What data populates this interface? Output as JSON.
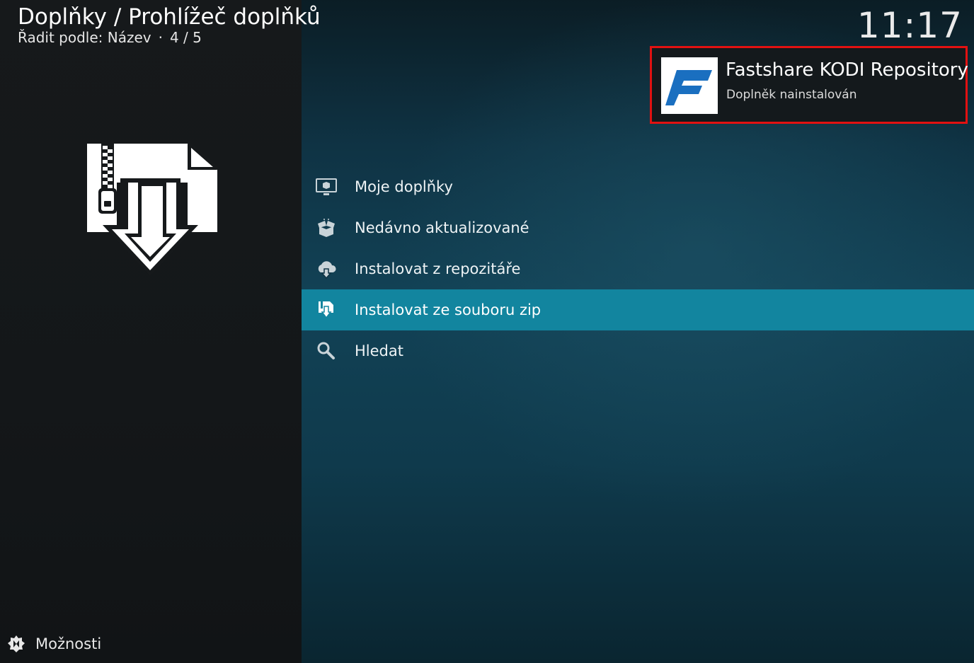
{
  "header": {
    "title": "Doplňky / Prohlížeč doplňků",
    "sort_label": "Řadit podle: Název",
    "separator": "·",
    "position": "4 / 5"
  },
  "clock": "11:17",
  "notification": {
    "title": "Fastshare KODI Repository",
    "message": "Doplněk nainstalován",
    "thumbnail_icon": "fastshare-logo-icon",
    "accent_color": "#1a6fc0",
    "highlight_color": "#e21111"
  },
  "hero": {
    "icon": "install-from-zip-icon"
  },
  "menu": {
    "selected_index": 3,
    "items": [
      {
        "label": "Moje doplňky",
        "icon": "monitor-box-icon"
      },
      {
        "label": "Nedávno aktualizované",
        "icon": "open-box-icon"
      },
      {
        "label": "Instalovat z repozitáře",
        "icon": "cloud-download-icon"
      },
      {
        "label": "Instalovat ze souboru zip",
        "icon": "zip-install-icon"
      },
      {
        "label": "Hledat",
        "icon": "search-icon"
      }
    ]
  },
  "footer": {
    "options_label": "Možnosti",
    "options_icon": "options-gear-icon"
  },
  "colors": {
    "selection": "#12859f",
    "left_panel": "#16191b"
  }
}
